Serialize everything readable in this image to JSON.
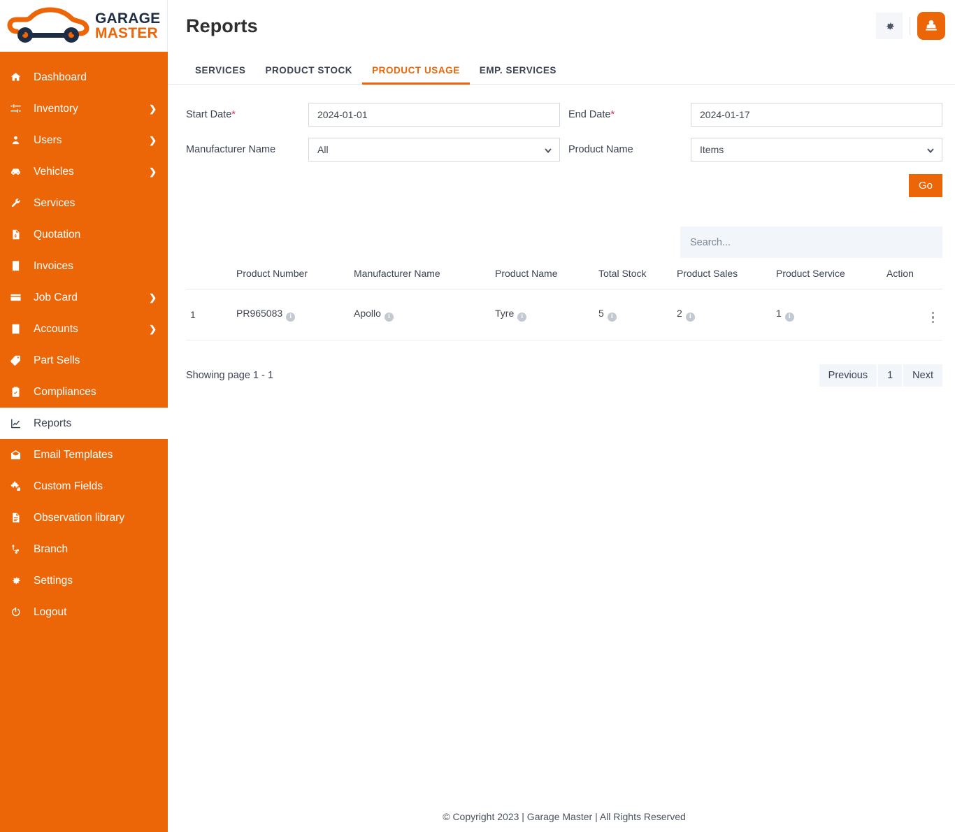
{
  "brand": {
    "logo_icon": "car-wrench-logo",
    "name_top": "GARAGE",
    "name_bottom": "MASTER",
    "accent_color": "#ec6608",
    "dark_color": "#1f2d44"
  },
  "sidebar": {
    "items": [
      {
        "label": "Dashboard",
        "icon": "home-icon",
        "has_caret": false,
        "active": false
      },
      {
        "label": "Inventory",
        "icon": "sliders-icon",
        "has_caret": true,
        "active": false
      },
      {
        "label": "Users",
        "icon": "user-icon",
        "has_caret": true,
        "active": false
      },
      {
        "label": "Vehicles",
        "icon": "car-icon",
        "has_caret": true,
        "active": false
      },
      {
        "label": "Services",
        "icon": "wrench-icon",
        "has_caret": false,
        "active": false
      },
      {
        "label": "Quotation",
        "icon": "quote-doc-icon",
        "has_caret": false,
        "active": false
      },
      {
        "label": "Invoices",
        "icon": "receipt-icon",
        "has_caret": false,
        "active": false
      },
      {
        "label": "Job Card",
        "icon": "card-icon",
        "has_caret": true,
        "active": false
      },
      {
        "label": "Accounts",
        "icon": "calculator-icon",
        "has_caret": true,
        "active": false
      },
      {
        "label": "Part Sells",
        "icon": "tag-icon",
        "has_caret": false,
        "active": false
      },
      {
        "label": "Compliances",
        "icon": "clipboard-check-icon",
        "has_caret": false,
        "active": false
      },
      {
        "label": "Reports",
        "icon": "chart-line-icon",
        "has_caret": false,
        "active": true
      },
      {
        "label": "Email Templates",
        "icon": "mail-open-icon",
        "has_caret": false,
        "active": false
      },
      {
        "label": "Custom Fields",
        "icon": "puzzle-icon",
        "has_caret": false,
        "active": false
      },
      {
        "label": "Observation library",
        "icon": "document-icon",
        "has_caret": false,
        "active": false
      },
      {
        "label": "Branch",
        "icon": "branch-icon",
        "has_caret": false,
        "active": false
      },
      {
        "label": "Settings",
        "icon": "gear-icon",
        "has_caret": false,
        "active": false
      },
      {
        "label": "Logout",
        "icon": "power-icon",
        "has_caret": false,
        "active": false
      }
    ],
    "caret_glyph": "❯"
  },
  "topbar": {
    "title": "Reports",
    "settings_icon": "gear-icon",
    "avatar_icon": "user-avatar-icon"
  },
  "tabs": [
    {
      "label": "SERVICES",
      "active": false
    },
    {
      "label": "PRODUCT STOCK",
      "active": false
    },
    {
      "label": "PRODUCT USAGE",
      "active": true
    },
    {
      "label": "EMP. SERVICES",
      "active": false
    }
  ],
  "filters": {
    "start_date": {
      "label": "Start Date",
      "required_mark": "*",
      "value": "2024-01-01"
    },
    "end_date": {
      "label": "End Date",
      "required_mark": "*",
      "value": "2024-01-17"
    },
    "manufacturer": {
      "label": "Manufacturer Name",
      "value": "All",
      "options": [
        "All"
      ]
    },
    "product": {
      "label": "Product Name",
      "value": "Items",
      "options": [
        "Items"
      ]
    },
    "go_label": "Go"
  },
  "search": {
    "placeholder": "Search...",
    "value": ""
  },
  "table": {
    "columns": [
      "",
      "Product Number",
      "Manufacturer Name",
      "Product Name",
      "Total Stock",
      "Product Sales",
      "Product Service",
      "Action"
    ],
    "rows": [
      {
        "index": "1",
        "product_number": "PR965083",
        "manufacturer_name": "Apollo",
        "product_name": "Tyre",
        "total_stock": "5",
        "product_sales": "2",
        "product_service": "1",
        "action_icon": "kebab-menu-icon"
      }
    ],
    "info_glyph": "i"
  },
  "pagination": {
    "showing": "Showing page 1 - 1",
    "previous": "Previous",
    "current": "1",
    "next": "Next"
  },
  "footer": {
    "text": "© Copyright 2023 | Garage Master | All Rights Reserved"
  }
}
